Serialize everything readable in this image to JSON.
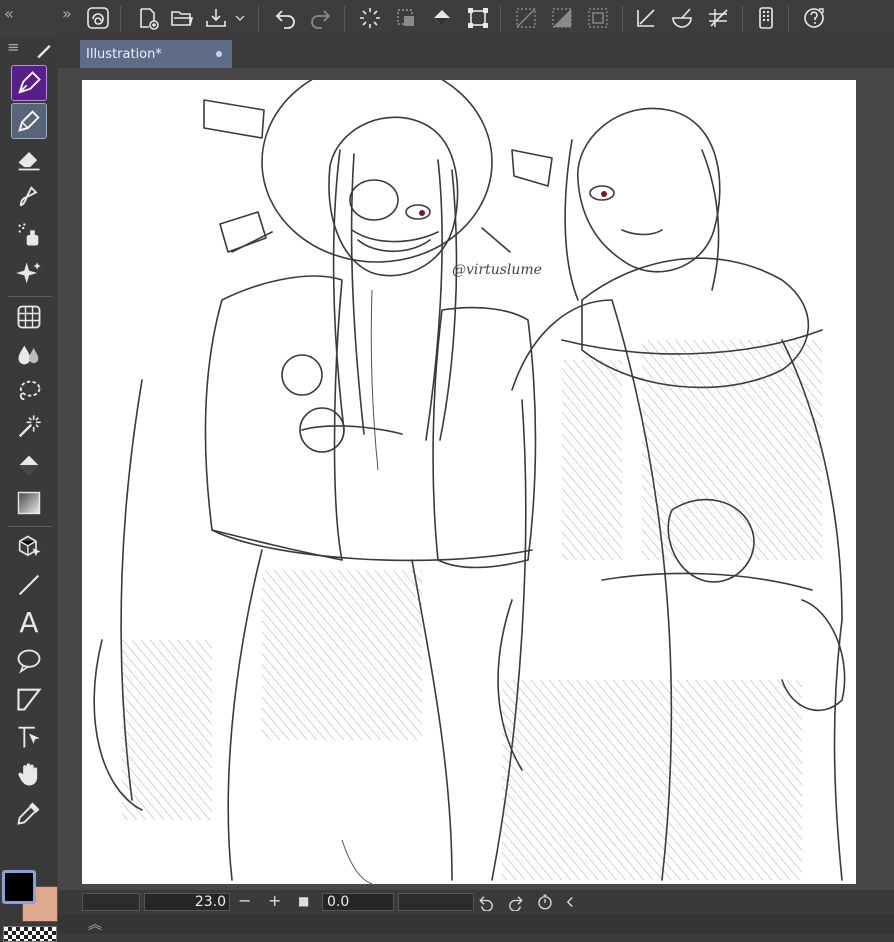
{
  "document": {
    "tab_title": "Illustration*",
    "signature": "@virtuslume"
  },
  "status": {
    "zoom_value": "23.0",
    "rotation_value": "0.0",
    "zoom_out_label": "−",
    "zoom_in_label": "+",
    "fit_label": "■"
  },
  "toolbar": {
    "text_tool_glyph": "A"
  },
  "colors": {
    "main": "#000000",
    "sub": "#e0a88c",
    "active_tool": "#5a1e8c",
    "selected_subtool": "#586478",
    "tab": "#5f6c87"
  }
}
